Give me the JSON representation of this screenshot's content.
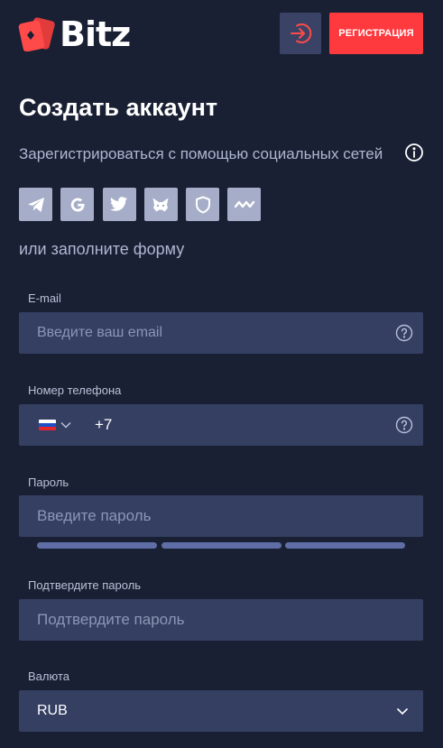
{
  "header": {
    "logo_text": "Bitz",
    "login_icon": "login-arrow-icon",
    "register_label": "РЕГИСТРАЦИЯ"
  },
  "page": {
    "title": "Создать аккаунт",
    "social_caption": "Зарегистрироваться с помощью социальных сетей",
    "or_caption": "или заполните форму"
  },
  "social": [
    {
      "name": "telegram-icon"
    },
    {
      "name": "google-icon"
    },
    {
      "name": "twitter-icon"
    },
    {
      "name": "metamask-icon"
    },
    {
      "name": "shield-icon"
    },
    {
      "name": "waves-icon"
    }
  ],
  "form": {
    "email": {
      "label": "E-mail",
      "placeholder": "Введите ваш email",
      "value": ""
    },
    "phone": {
      "label": "Номер телефона",
      "code": "+7",
      "country": "RU"
    },
    "password": {
      "label": "Пароль",
      "placeholder": "Введите пароль",
      "value": ""
    },
    "confirm": {
      "label": "Подтвердите пароль",
      "placeholder": "Подтвердите пароль",
      "value": ""
    },
    "currency": {
      "label": "Валюта",
      "value": "RUB"
    }
  },
  "colors": {
    "background": "#1a2033",
    "field": "#343f62",
    "accent": "#ff3a3f",
    "strength_bar": "#5f6ea6"
  }
}
